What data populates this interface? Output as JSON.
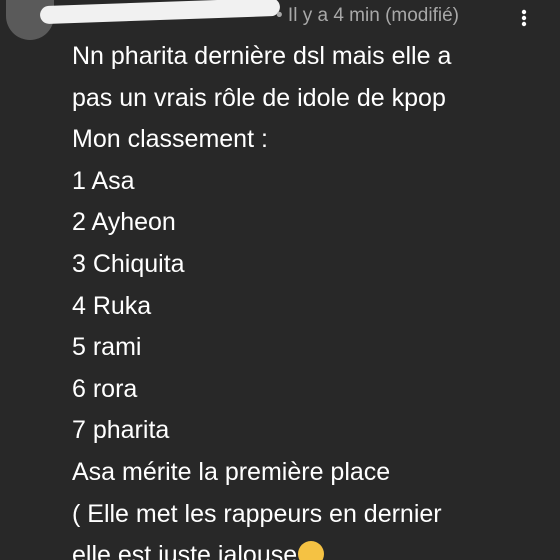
{
  "header": {
    "meta_text": "• Il y a 4 min (modifié)",
    "more_icon": "more-vertical-icon"
  },
  "comment": {
    "lines": [
      "Nn pharita dernière dsl mais elle a",
      "pas un vrais rôle de idole de kpop",
      "Mon classement :",
      "1 Asa",
      "2 Ayheon",
      "3 Chiquita",
      "4 Ruka",
      "5 rami",
      "6 rora",
      "7 pharita",
      "Asa mérite la première place",
      "( Elle met les rappeurs en dernier",
      "elle est juste jalouse"
    ],
    "trailing_emoji": "😒"
  },
  "colors": {
    "background": "#282828",
    "text": "#ffffff",
    "meta_text": "#a8a8a8"
  }
}
